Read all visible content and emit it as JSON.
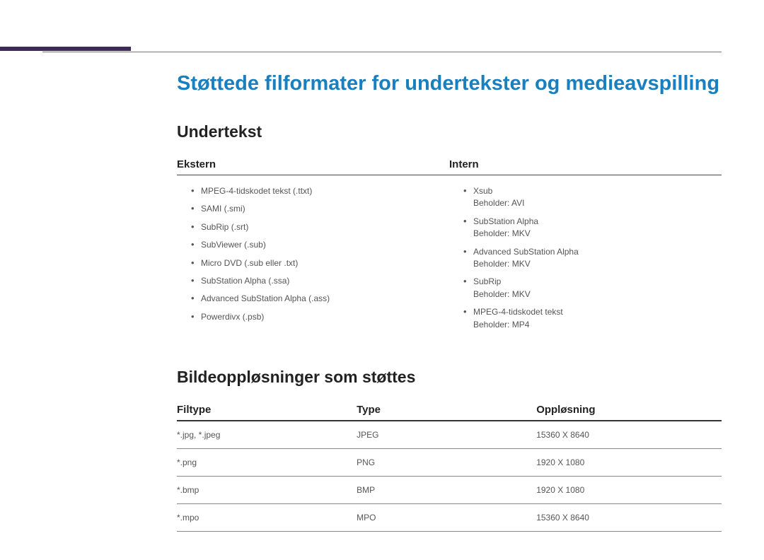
{
  "heading": "Støttede filformater for undertekster og medieavspilling",
  "section1": {
    "title": "Undertekst",
    "left": {
      "header": "Ekstern",
      "items": [
        {
          "line": "MPEG-4-tidskodet tekst (.ttxt)"
        },
        {
          "line": "SAMI (.smi)"
        },
        {
          "line": "SubRip (.srt)"
        },
        {
          "line": "SubViewer (.sub)"
        },
        {
          "line": "Micro DVD (.sub eller .txt)"
        },
        {
          "line": "SubStation Alpha (.ssa)"
        },
        {
          "line": "Advanced SubStation Alpha (.ass)"
        },
        {
          "line": "Powerdivx (.psb)"
        }
      ]
    },
    "right": {
      "header": "Intern",
      "items": [
        {
          "line": "Xsub",
          "sub": "Beholder: AVI"
        },
        {
          "line": "SubStation Alpha",
          "sub": "Beholder: MKV"
        },
        {
          "line": "Advanced SubStation Alpha",
          "sub": "Beholder: MKV"
        },
        {
          "line": "SubRip",
          "sub": "Beholder: MKV"
        },
        {
          "line": "MPEG-4-tidskodet tekst",
          "sub": "Beholder: MP4"
        }
      ]
    }
  },
  "section2": {
    "title": "Bildeoppløsninger som støttes",
    "columns": [
      "Filtype",
      "Type",
      "Oppløsning"
    ],
    "rows": [
      {
        "filetype": "*.jpg, *.jpeg",
        "type": "JPEG",
        "res": "15360 X 8640"
      },
      {
        "filetype": "*.png",
        "type": "PNG",
        "res": "1920 X 1080"
      },
      {
        "filetype": "*.bmp",
        "type": "BMP",
        "res": "1920 X 1080"
      },
      {
        "filetype": "*.mpo",
        "type": "MPO",
        "res": "15360 X 8640"
      }
    ]
  }
}
